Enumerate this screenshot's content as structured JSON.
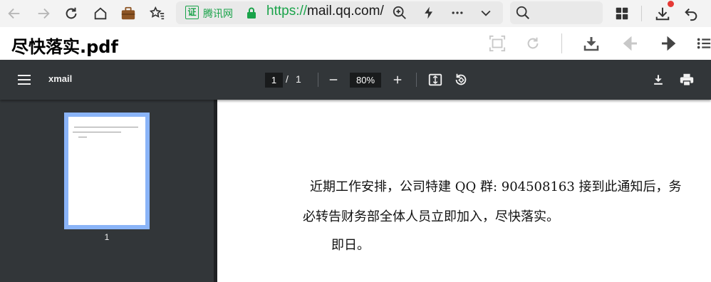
{
  "browser": {
    "cert_badge": "证",
    "cert_text": "腾讯网",
    "url_scheme": "https://",
    "url_host": "mail.qq.com/",
    "search": {
      "placeholder": ""
    },
    "download_badge_color": "#e53935",
    "icons": [
      "back-icon",
      "forward-icon",
      "reload-icon",
      "home-icon",
      "briefcase-icon",
      "favorites-icon",
      "zoom-icon",
      "lightning-icon",
      "more-icon",
      "chevron-down-icon",
      "search-icon",
      "grid-icon",
      "download-icon",
      "undo-icon"
    ]
  },
  "title_row": {
    "title": "尽快落实.pdf"
  },
  "pdf_toolbar": {
    "doc_name": "xmail",
    "page_current": "1",
    "page_separator": "/",
    "page_total": "1",
    "zoom": "80%"
  },
  "sidebar": {
    "thumbnail_label": "1",
    "thumb_border_color": "#8ab4f8"
  },
  "document": {
    "line1": "近期工作安排，公司特建 QQ 群: 904508163 接到此通知后，务",
    "line2": "必转告财务部全体人员立即加入，尽快落实。",
    "line3": "即日。"
  },
  "colors": {
    "toolbar_bg": "#323639",
    "secure_green": "#1aa34a"
  }
}
